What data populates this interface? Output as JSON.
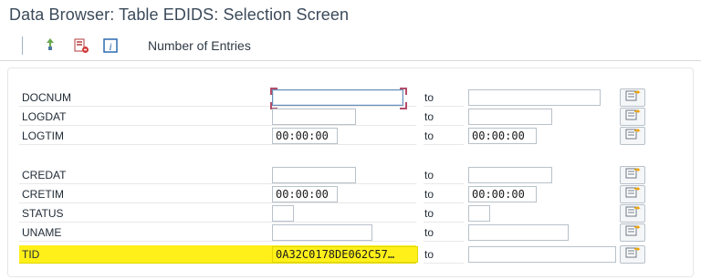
{
  "window": {
    "title": "Data Browser: Table EDIDS: Selection Screen"
  },
  "toolbar": {
    "icons": [
      "execute-icon",
      "delete-selection-icon",
      "info-icon"
    ],
    "number_of_entries_label": "Number of Entries"
  },
  "selection": {
    "to_label": "to",
    "rows": [
      {
        "name": "DOCNUM",
        "from_value": "",
        "to_value": "",
        "focused": true
      },
      {
        "name": "LOGDAT",
        "from_value": "",
        "to_value": ""
      },
      {
        "name": "LOGTIM",
        "from_value": "00:00:00",
        "to_value": "00:00:00"
      },
      {
        "name": "CREDAT",
        "from_value": "",
        "to_value": ""
      },
      {
        "name": "CRETIM",
        "from_value": "00:00:00",
        "to_value": "00:00:00"
      },
      {
        "name": "STATUS",
        "from_value": "",
        "to_value": ""
      },
      {
        "name": "UNAME",
        "from_value": "",
        "to_value": ""
      },
      {
        "name": "TID",
        "from_value": "0A32C0178DE062C57…",
        "to_value": "",
        "highlighted": true
      }
    ]
  },
  "colors": {
    "highlight": "#fff01a",
    "accent": "#0066cc"
  }
}
